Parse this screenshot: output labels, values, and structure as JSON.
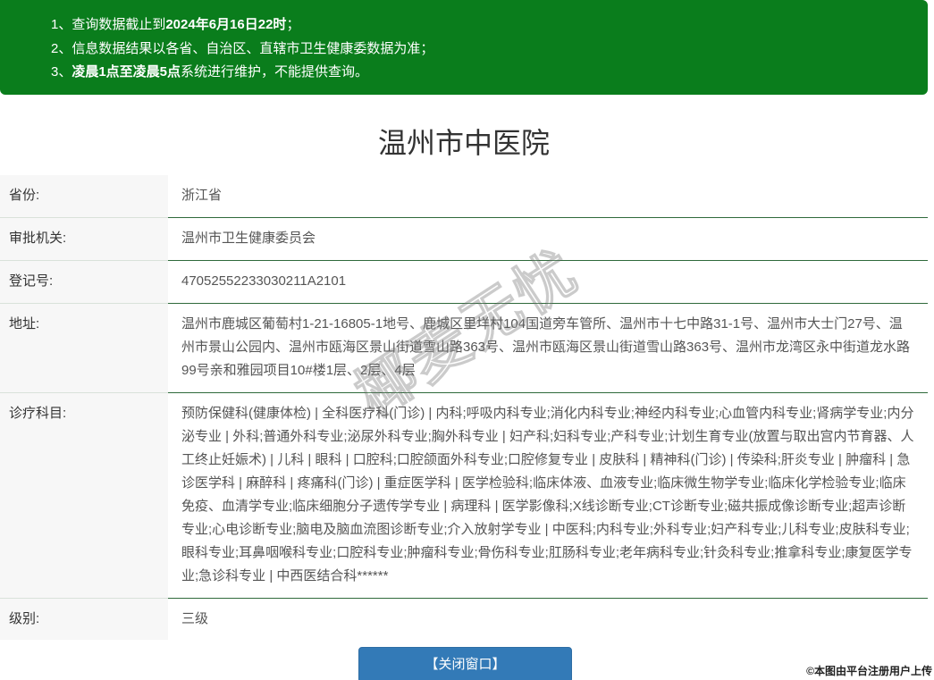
{
  "colors": {
    "notice_bg": "#0a7d1c",
    "button_bg": "#337ab7",
    "row_border": "#2f6a3b"
  },
  "notice": {
    "line1": {
      "text": "1、查询数据截止到",
      "highlight": "2024年6月16日22时",
      "end": "；"
    },
    "line2": {
      "text": "2、信息数据结果以各省、自治区、直辖市卫生健康委数据为准；"
    },
    "line3": {
      "start": "3、",
      "highlight": "凌晨1点至凌晨5点",
      "text": "系统进行维护，不能提供查询。"
    }
  },
  "hospital": {
    "name": "温州市中医院"
  },
  "details": [
    {
      "label": "省份:",
      "value": "浙江省"
    },
    {
      "label": "审批机关:",
      "value": "温州市卫生健康委员会"
    },
    {
      "label": "登记号:",
      "value": "47052552233030211A2101"
    },
    {
      "label": "地址:",
      "value": "温州市鹿城区葡萄村1-21-16805-1地号、鹿城区里垟村104国道旁车管所、温州市十七中路31-1号、温州市大士门27号、温州市景山公园内、温州市瓯海区景山街道雪山路363号、温州市瓯海区景山街道雪山路363号、温州市龙湾区永中街道龙水路99号亲和雅园项目10#楼1层、2层、4层"
    },
    {
      "label": "诊疗科目:",
      "value": "预防保健科(健康体检) | 全科医疗科(门诊) | 内科;呼吸内科专业;消化内科专业;神经内科专业;心血管内科专业;肾病学专业;内分泌专业 | 外科;普通外科专业;泌尿外科专业;胸外科专业 | 妇产科;妇科专业;产科专业;计划生育专业(放置与取出宫内节育器、人工终止妊娠术) | 儿科 | 眼科 | 口腔科;口腔颌面外科专业;口腔修复专业 | 皮肤科 | 精神科(门诊) | 传染科;肝炎专业 | 肿瘤科 | 急诊医学科 | 麻醉科 | 疼痛科(门诊) | 重症医学科 | 医学检验科;临床体液、血液专业;临床微生物学专业;临床化学检验专业;临床免疫、血清学专业;临床细胞分子遗传学专业 | 病理科 | 医学影像科;X线诊断专业;CT诊断专业;磁共振成像诊断专业;超声诊断专业;心电诊断专业;脑电及脑血流图诊断专业;介入放射学专业 | 中医科;内科专业;外科专业;妇产科专业;儿科专业;皮肤科专业;眼科专业;耳鼻咽喉科专业;口腔科专业;肿瘤科专业;骨伤科专业;肛肠科专业;老年病科专业;针灸科专业;推拿科专业;康复医学专业;急诊科专业 | 中西医结合科******"
    },
    {
      "label": "级别:",
      "value": "三级"
    }
  ],
  "footer": {
    "close_button": "【关闭窗口】"
  },
  "watermarks": {
    "site": "椰麦无忧",
    "upload_notice": "©本图由平台注册用户上传"
  }
}
